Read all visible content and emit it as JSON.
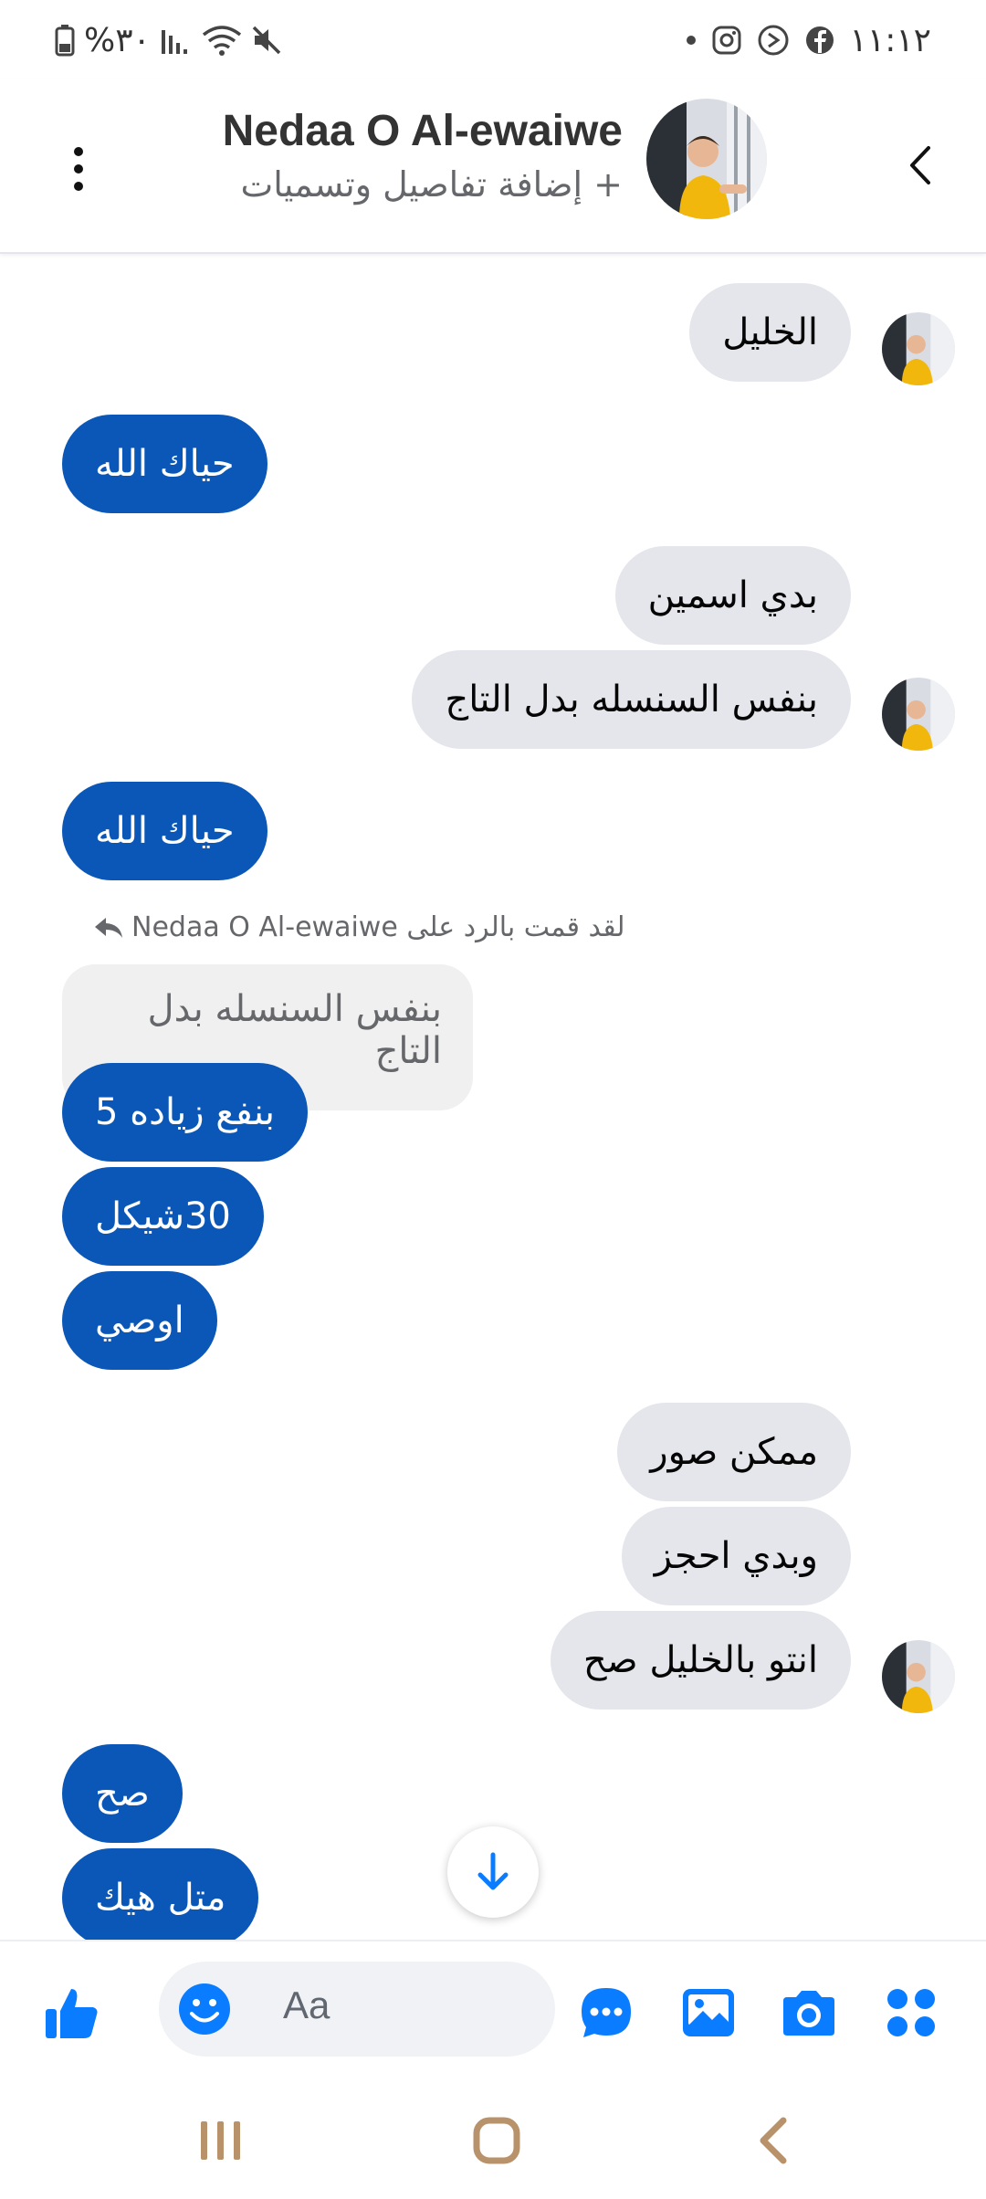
{
  "status_bar": {
    "battery_text": "%٣٠",
    "time": "١١:١٢",
    "icons": [
      "battery-icon",
      "signal-icon",
      "wifi-icon",
      "mute-icon",
      "dot-icon",
      "instagram-icon",
      "viber-icon",
      "facebook-icon"
    ]
  },
  "header": {
    "name": "Nedaa O Al-ewaiwe",
    "subtitle": "+ إضافة تفاصيل وتسميات"
  },
  "messages": [
    {
      "side": "in",
      "text": "الخليل"
    },
    {
      "side": "out",
      "text": "حياك الله"
    },
    {
      "side": "in",
      "text": "بدي اسمين"
    },
    {
      "side": "in",
      "text": "بنفس السنسله بدل التاج"
    },
    {
      "side": "out",
      "text": "حياك الله"
    },
    {
      "side": "out",
      "text": "بنفع زياده 5"
    },
    {
      "side": "out",
      "text": "30شيكل"
    },
    {
      "side": "out",
      "text": "اوصي"
    },
    {
      "side": "in",
      "text": "ممكن صور"
    },
    {
      "side": "in",
      "text": "وبدي احجز"
    },
    {
      "side": "in",
      "text": "انتو بالخليل صح"
    },
    {
      "side": "out",
      "text": "صح"
    },
    {
      "side": "out",
      "text": "متل هيك"
    }
  ],
  "reply": {
    "label": "لقد قمت بالرد على Nedaa O Al-ewaiwe",
    "quoted_text": "بنفس السنسله بدل التاج"
  },
  "composer": {
    "placeholder": "Aa"
  },
  "colors": {
    "accent": "#0a57b8",
    "icon_blue": "#0a7cff",
    "incoming_bubble": "#e4e6eb",
    "nav_icon": "#b8926a"
  }
}
